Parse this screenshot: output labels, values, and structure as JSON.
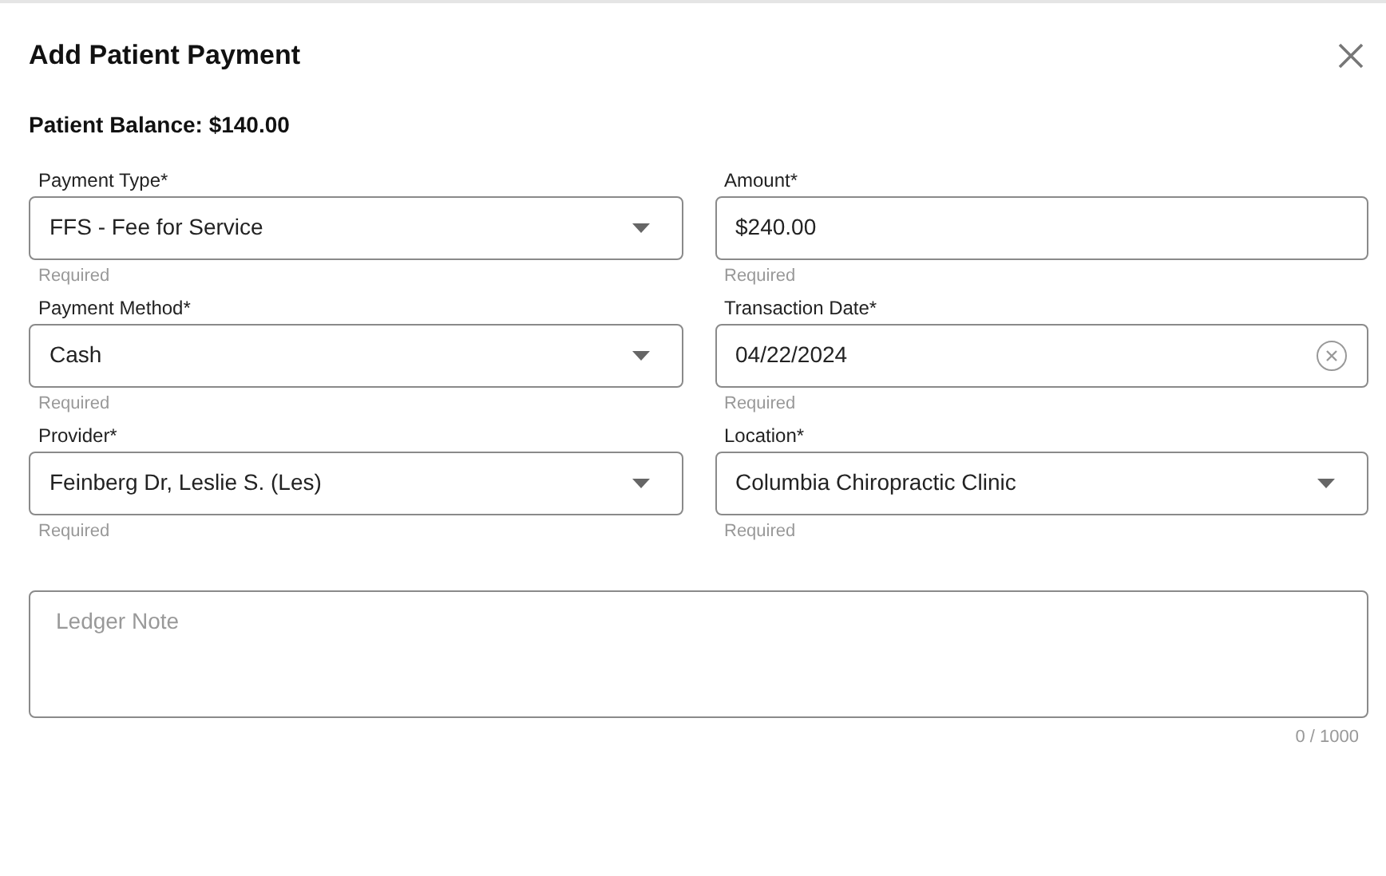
{
  "dialog": {
    "title": "Add Patient Payment",
    "balance": "Patient Balance: $140.00"
  },
  "fields": [
    {
      "kind": "select",
      "label": "Payment Type*",
      "value": "FFS - Fee for Service",
      "hint": "Required"
    },
    {
      "kind": "text",
      "label": "Amount*",
      "value": "$240.00",
      "hint": "Required"
    },
    {
      "kind": "select",
      "label": "Payment Method*",
      "value": "Cash",
      "hint": "Required"
    },
    {
      "kind": "date",
      "label": "Transaction Date*",
      "value": "04/22/2024",
      "hint": "Required"
    },
    {
      "kind": "select",
      "label": "Provider*",
      "value": "Feinberg Dr, Leslie S. (Les)",
      "hint": "Required"
    },
    {
      "kind": "select",
      "label": "Location*",
      "value": "Columbia Chiropractic Clinic",
      "hint": "Required"
    }
  ],
  "ledger_note": {
    "placeholder": "Ledger Note",
    "counter": "0 / 1000"
  }
}
